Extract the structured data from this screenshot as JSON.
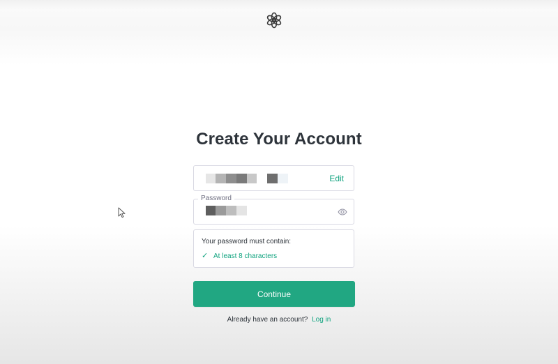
{
  "page": {
    "title": "Create Your Account"
  },
  "brand": {
    "logo_icon": "openai-logo-icon",
    "accent_color": "#10a37f",
    "button_color": "#21a782"
  },
  "email_field": {
    "value_redacted": true,
    "edit_label": "Edit"
  },
  "password_field": {
    "label": "Password",
    "value_redacted": true,
    "toggle_icon": "eye-icon"
  },
  "password_rules": {
    "heading": "Your password must contain:",
    "items": [
      {
        "icon": "check-icon",
        "check_glyph": "✓",
        "label": "At least 8 characters"
      }
    ]
  },
  "actions": {
    "continue_label": "Continue"
  },
  "footer": {
    "prompt": "Already have an account?",
    "login_label": "Log in"
  }
}
